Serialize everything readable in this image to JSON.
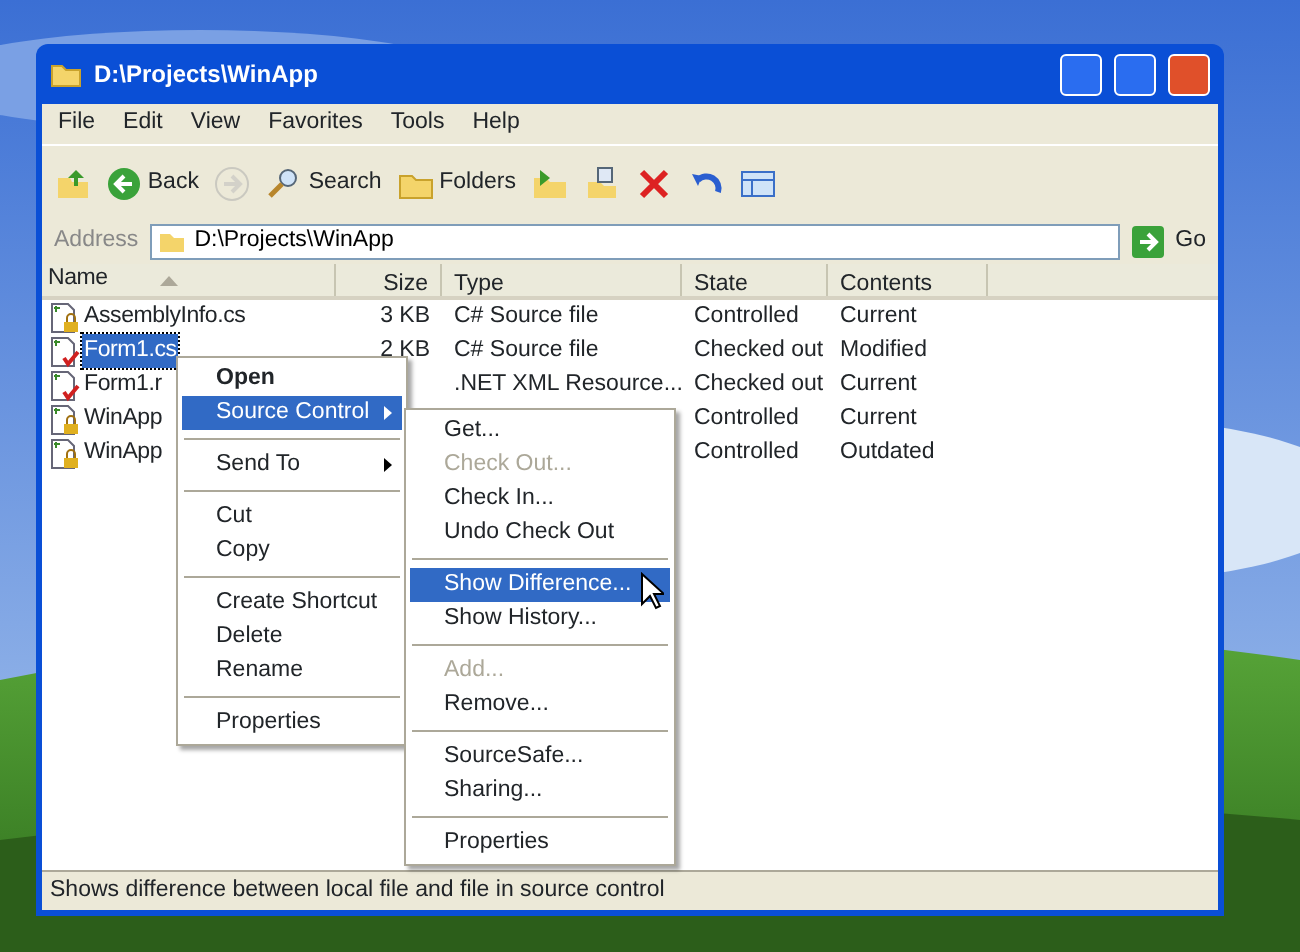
{
  "window": {
    "title": "D:\\Projects\\WinApp"
  },
  "menu_bar": [
    "File",
    "Edit",
    "View",
    "Favorites",
    "Tools",
    "Help"
  ],
  "toolbar": [
    {
      "kind": "up"
    },
    {
      "kind": "back",
      "label": "Back"
    },
    {
      "kind": "forward",
      "disabled": true
    },
    {
      "kind": "search",
      "label": "Search"
    },
    {
      "kind": "folders",
      "label": "Folders"
    },
    {
      "kind": "move"
    },
    {
      "kind": "copy"
    },
    {
      "kind": "delete"
    },
    {
      "kind": "undo"
    },
    {
      "kind": "views"
    }
  ],
  "address": {
    "label": "Address",
    "value": "D:\\Projects\\WinApp",
    "go": "Go"
  },
  "file_list": {
    "columns": [
      "Name",
      "Size",
      "Type",
      "State",
      "Contents"
    ],
    "rows": [
      {
        "name": "AssemblyInfo.cs",
        "kind": "lock",
        "selected": false,
        "size": "3 KB",
        "type": "C# Source file",
        "state": "Controlled",
        "contents": "Current"
      },
      {
        "name": "Form1.cs",
        "kind": "check",
        "selected": true,
        "size": "2 KB",
        "type": "C# Source file",
        "state": "Checked out",
        "contents": "Modified"
      },
      {
        "name": "Form1.r",
        "kind": "check",
        "selected": false,
        "type": ".NET XML Resource...",
        "state": "Checked out",
        "contents": "Current"
      },
      {
        "name": "WinApp",
        "kind": "lock",
        "selected": false,
        "state": "Controlled",
        "contents": "Current"
      },
      {
        "name": "WinApp",
        "kind": "lock",
        "selected": false,
        "state": "Controlled",
        "contents": "Outdated"
      }
    ]
  },
  "context_menu": [
    {
      "kind": "item",
      "label": "Open",
      "bold": true
    },
    {
      "kind": "item",
      "label": "Source Control",
      "submenu": true,
      "selected": true
    },
    {
      "kind": "separator"
    },
    {
      "kind": "item",
      "label": "Send To",
      "submenu": true
    },
    {
      "kind": "separator"
    },
    {
      "kind": "item",
      "label": "Cut"
    },
    {
      "kind": "item",
      "label": "Copy"
    },
    {
      "kind": "separator"
    },
    {
      "kind": "item",
      "label": "Create Shortcut"
    },
    {
      "kind": "item",
      "label": "Delete"
    },
    {
      "kind": "item",
      "label": "Rename"
    },
    {
      "kind": "separator"
    },
    {
      "kind": "item",
      "label": "Properties"
    }
  ],
  "submenu": [
    {
      "kind": "item",
      "label": "Get..."
    },
    {
      "kind": "item",
      "label": "Check Out...",
      "disabled": true
    },
    {
      "kind": "item",
      "label": "Check In..."
    },
    {
      "kind": "item",
      "label": "Undo Check Out"
    },
    {
      "kind": "separator"
    },
    {
      "kind": "item",
      "label": "Show Difference...",
      "selected": true
    },
    {
      "kind": "item",
      "label": "Show History..."
    },
    {
      "kind": "separator"
    },
    {
      "kind": "item",
      "label": "Add...",
      "disabled": true
    },
    {
      "kind": "item",
      "label": "Remove..."
    },
    {
      "kind": "separator"
    },
    {
      "kind": "item",
      "label": "SourceSafe..."
    },
    {
      "kind": "item",
      "label": "Sharing..."
    },
    {
      "kind": "separator"
    },
    {
      "kind": "item",
      "label": "Properties"
    }
  ],
  "status_bar": "Shows difference between local file and file in source control"
}
